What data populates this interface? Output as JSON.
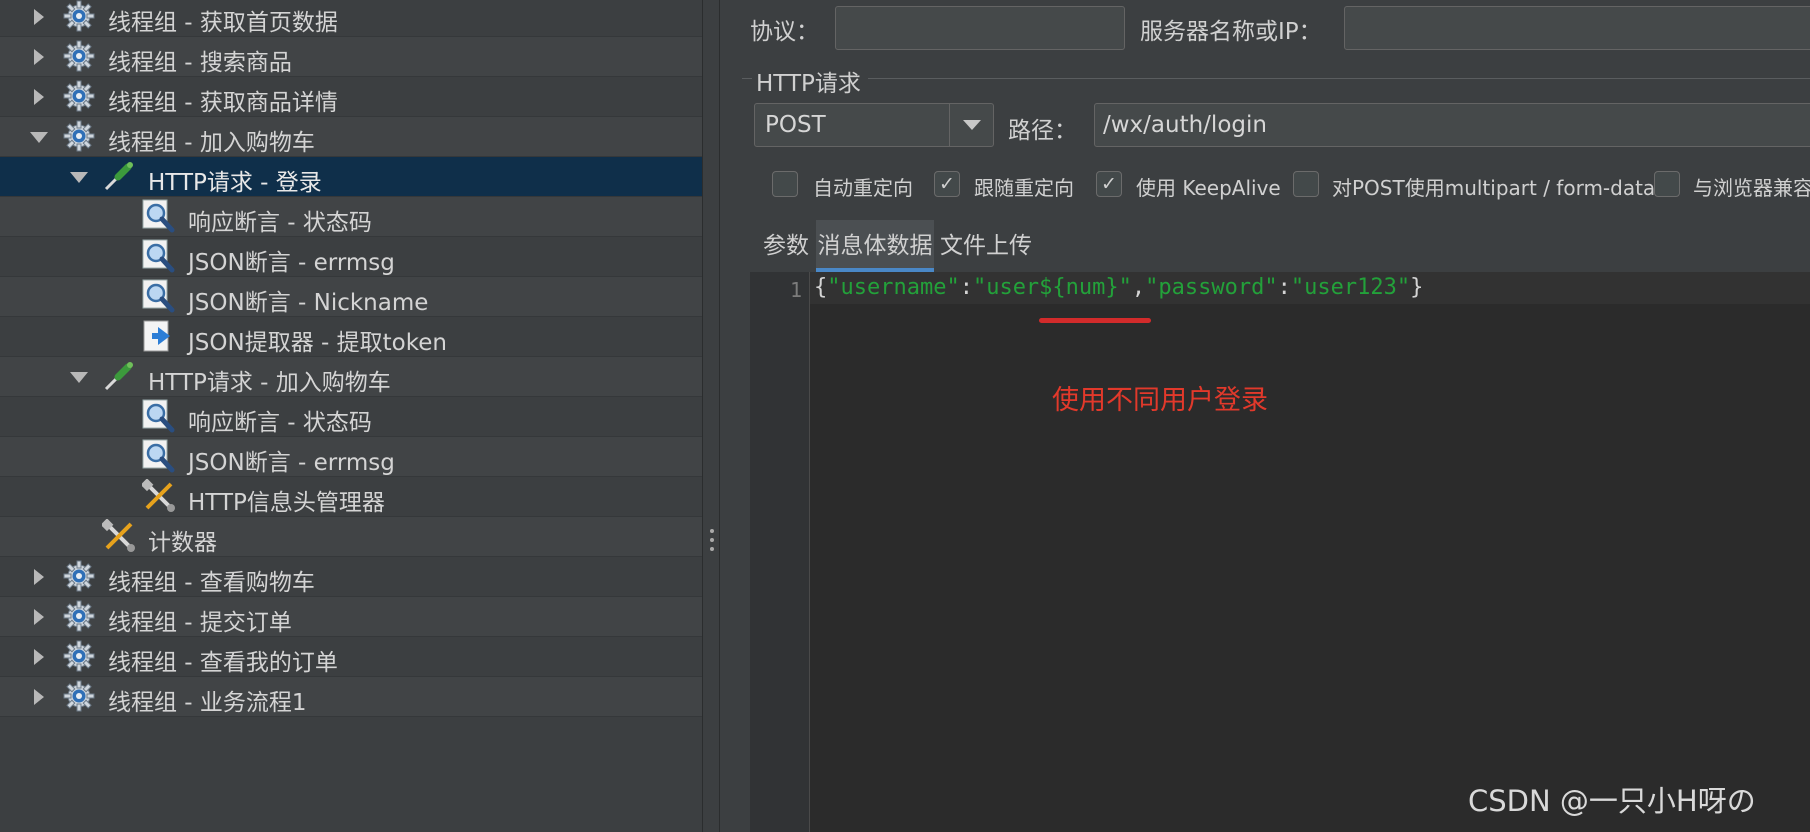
{
  "tree": {
    "items": [
      {
        "label": "线程组 - 获取首页数据",
        "icon": "thread-group-gear-icon",
        "expand": "collapsed"
      },
      {
        "label": "线程组 - 搜索商品",
        "icon": "thread-group-gear-icon",
        "expand": "collapsed"
      },
      {
        "label": "线程组 - 获取商品详情",
        "icon": "thread-group-gear-icon",
        "expand": "collapsed"
      },
      {
        "label": "线程组 - 加入购物车",
        "icon": "thread-group-gear-icon",
        "expand": "expanded"
      },
      {
        "label": "HTTP请求 - 登录",
        "icon": "http-sampler-pipette-icon",
        "expand": "expanded",
        "selected": true
      },
      {
        "label": "响应断言 - 状态码",
        "icon": "assertion-magnifier-icon"
      },
      {
        "label": "JSON断言 - errmsg",
        "icon": "assertion-magnifier-icon"
      },
      {
        "label": "JSON断言 - Nickname",
        "icon": "assertion-magnifier-icon"
      },
      {
        "label": "JSON提取器 - 提取token",
        "icon": "extractor-icon"
      },
      {
        "label": "HTTP请求 - 加入购物车",
        "icon": "http-sampler-pipette-icon",
        "expand": "expanded"
      },
      {
        "label": "响应断言 - 状态码",
        "icon": "assertion-magnifier-icon"
      },
      {
        "label": "JSON断言 - errmsg",
        "icon": "assertion-magnifier-icon"
      },
      {
        "label": "HTTP信息头管理器",
        "icon": "config-tools-icon"
      },
      {
        "label": "计数器",
        "icon": "config-tools-icon"
      },
      {
        "label": "线程组 - 查看购物车",
        "icon": "thread-group-gear-icon",
        "expand": "collapsed"
      },
      {
        "label": "线程组 - 提交订单",
        "icon": "thread-group-gear-icon",
        "expand": "collapsed"
      },
      {
        "label": "线程组 - 查看我的订单",
        "icon": "thread-group-gear-icon",
        "expand": "collapsed"
      },
      {
        "label": "线程组 - 业务流程1",
        "icon": "thread-group-gear-icon",
        "expand": "collapsed"
      }
    ]
  },
  "panel": {
    "protocol_label": "协议：",
    "protocol_value": "",
    "server_label": "服务器名称或IP：",
    "server_value": "",
    "http_group_title": "HTTP请求",
    "method": "POST",
    "path_label": "路径：",
    "path_value": "/wx/auth/login",
    "checkboxes": [
      {
        "label": "自动重定向",
        "checked": false
      },
      {
        "label": "跟随重定向",
        "checked": true
      },
      {
        "label": "使用 KeepAlive",
        "checked": true
      },
      {
        "label": "对POST使用multipart / form-data",
        "checked": false
      },
      {
        "label": "与浏览器兼容",
        "checked": false
      }
    ],
    "tabs": [
      "参数",
      "消息体数据",
      "文件上传"
    ],
    "active_tab": "消息体数据",
    "body": {
      "line_number": "1",
      "tokens": [
        {
          "t": "{",
          "k": "punc"
        },
        {
          "t": "\"username\"",
          "k": "str"
        },
        {
          "t": ":",
          "k": "punc"
        },
        {
          "t": "\"user${num}\"",
          "k": "str"
        },
        {
          "t": ",",
          "k": "punc"
        },
        {
          "t": "\"password\"",
          "k": "str"
        },
        {
          "t": ":",
          "k": "punc"
        },
        {
          "t": "\"user123\"",
          "k": "str"
        },
        {
          "t": "}",
          "k": "punc"
        }
      ]
    },
    "annotation": "使用不同用户登录",
    "watermark": "CSDN @一只小H呀の"
  },
  "colors": {
    "string": "#23a13a",
    "annotation": "#e2392b",
    "selection": "#0f2f4a",
    "tab_underline": "#4a88c7"
  }
}
